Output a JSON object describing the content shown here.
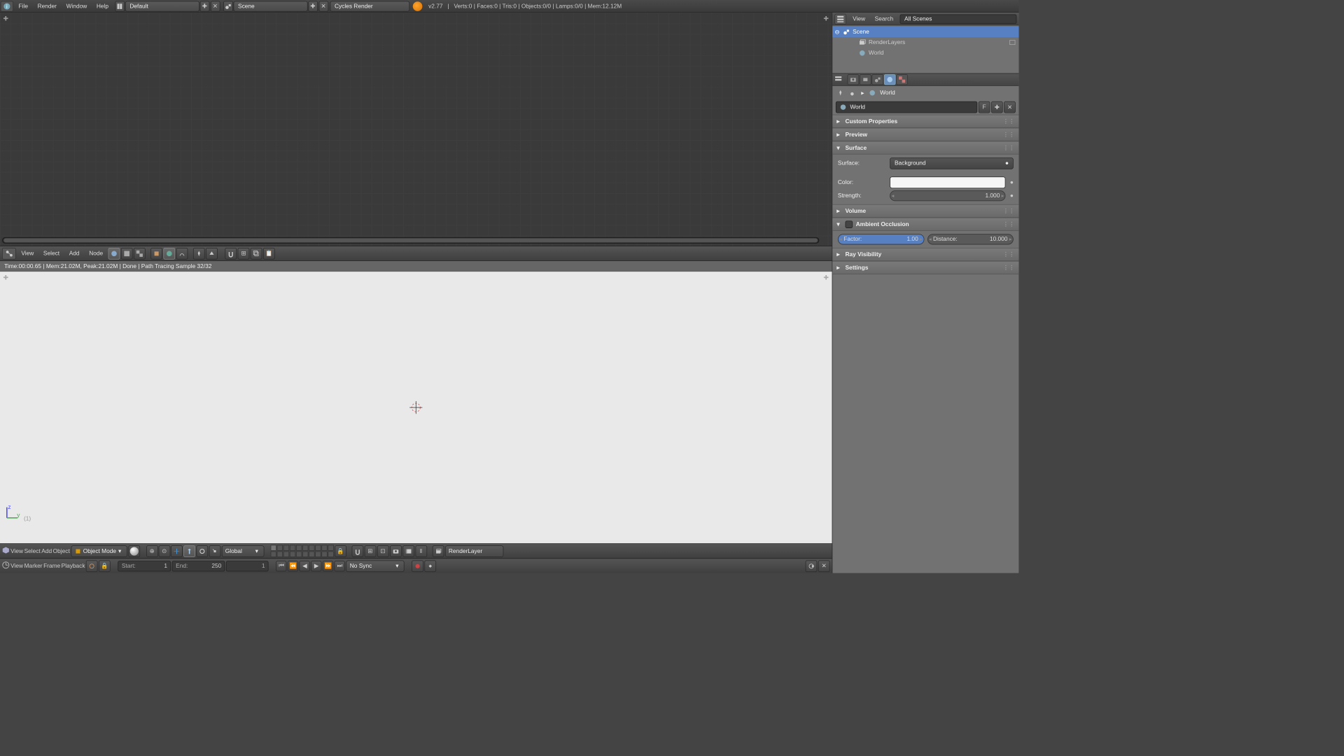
{
  "topbar": {
    "menus": [
      "File",
      "Render",
      "Window",
      "Help"
    ],
    "layout": "Default",
    "scene": "Scene",
    "engine": "Cycles Render",
    "version": "v2.77",
    "stats": "Verts:0 | Faces:0 | Tris:0 | Objects:0/0 | Lamps:0/0 | Mem:12.12M"
  },
  "nodeEditor": {
    "menus": [
      "View",
      "Select",
      "Add",
      "Node"
    ]
  },
  "renderInfo": "Time:00:00.65 | Mem:21.02M, Peak:21.02M | Done | Path Tracing Sample 32/32",
  "view3d": {
    "menus": [
      "View",
      "Select",
      "Add",
      "Object"
    ],
    "mode": "Object Mode",
    "orientation": "Global",
    "layer": "RenderLayer",
    "overlay_label": "(1)"
  },
  "timeline": {
    "menus": [
      "View",
      "Marker",
      "Frame",
      "Playback"
    ],
    "start_label": "Start:",
    "start": "1",
    "end_label": "End:",
    "end": "250",
    "current": "1",
    "sync": "No Sync"
  },
  "outliner": {
    "menus": [
      "View",
      "Search"
    ],
    "filter": "All Scenes",
    "tree": {
      "scene": "Scene",
      "renderlayers": "RenderLayers",
      "world": "World"
    }
  },
  "properties": {
    "breadcrumb": "World",
    "datablock": "World",
    "fake": "F",
    "panels": {
      "custom": "Custom Properties",
      "preview": "Preview",
      "surface": {
        "title": "Surface",
        "surface_label": "Surface:",
        "surface_value": "Background",
        "color_label": "Color:",
        "strength_label": "Strength:",
        "strength_value": "1.000"
      },
      "volume": "Volume",
      "ao": {
        "title": "Ambient Occlusion",
        "factor_label": "Factor:",
        "factor_value": "1.00",
        "distance_label": "Distance:",
        "distance_value": "10.000"
      },
      "ray": "Ray Visibility",
      "settings": "Settings"
    }
  }
}
